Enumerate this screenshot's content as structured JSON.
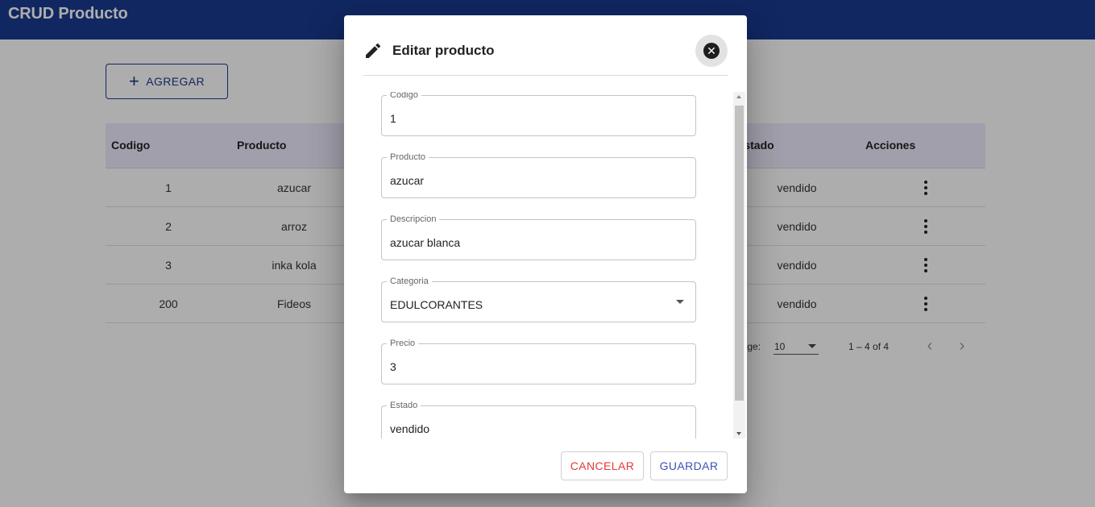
{
  "app": {
    "title": "CRUD Producto"
  },
  "toolbar": {
    "add_label": "AGREGAR"
  },
  "table": {
    "headers": {
      "codigo": "Codigo",
      "producto": "Producto",
      "estado": "Estado",
      "acciones": "Acciones"
    },
    "rows": [
      {
        "codigo": "1",
        "producto": "azucar",
        "estado": "vendido"
      },
      {
        "codigo": "2",
        "producto": "arroz",
        "estado": "vendido"
      },
      {
        "codigo": "3",
        "producto": "inka kola",
        "estado": "vendido"
      },
      {
        "codigo": "200",
        "producto": "Fideos",
        "estado": "vendido"
      }
    ]
  },
  "pagination": {
    "rows_per_page_label": "Rows per page:",
    "rows_per_page": "10",
    "range": "1 – 4 of 4"
  },
  "dialog": {
    "title": "Editar producto",
    "fields": {
      "codigo": {
        "label": "Codigo",
        "value": "1"
      },
      "producto": {
        "label": "Producto",
        "value": "azucar"
      },
      "descripcion": {
        "label": "Descripcion",
        "value": "azucar blanca"
      },
      "categoria": {
        "label": "Categoria",
        "value": "EDULCORANTES"
      },
      "precio": {
        "label": "Precio",
        "value": "3"
      },
      "estado": {
        "label": "Estado",
        "value": "vendido"
      }
    },
    "cancel_label": "CANCELAR",
    "save_label": "GUARDAR"
  },
  "colors": {
    "appbar": "#1a3a8f",
    "header_row": "#eceafc",
    "cancel": "#e53935",
    "save": "#3f51b5"
  },
  "icons": {
    "add": "plus-icon",
    "edit": "pencil-icon",
    "close": "close-circle-icon",
    "row_actions": "more-vert-icon"
  }
}
